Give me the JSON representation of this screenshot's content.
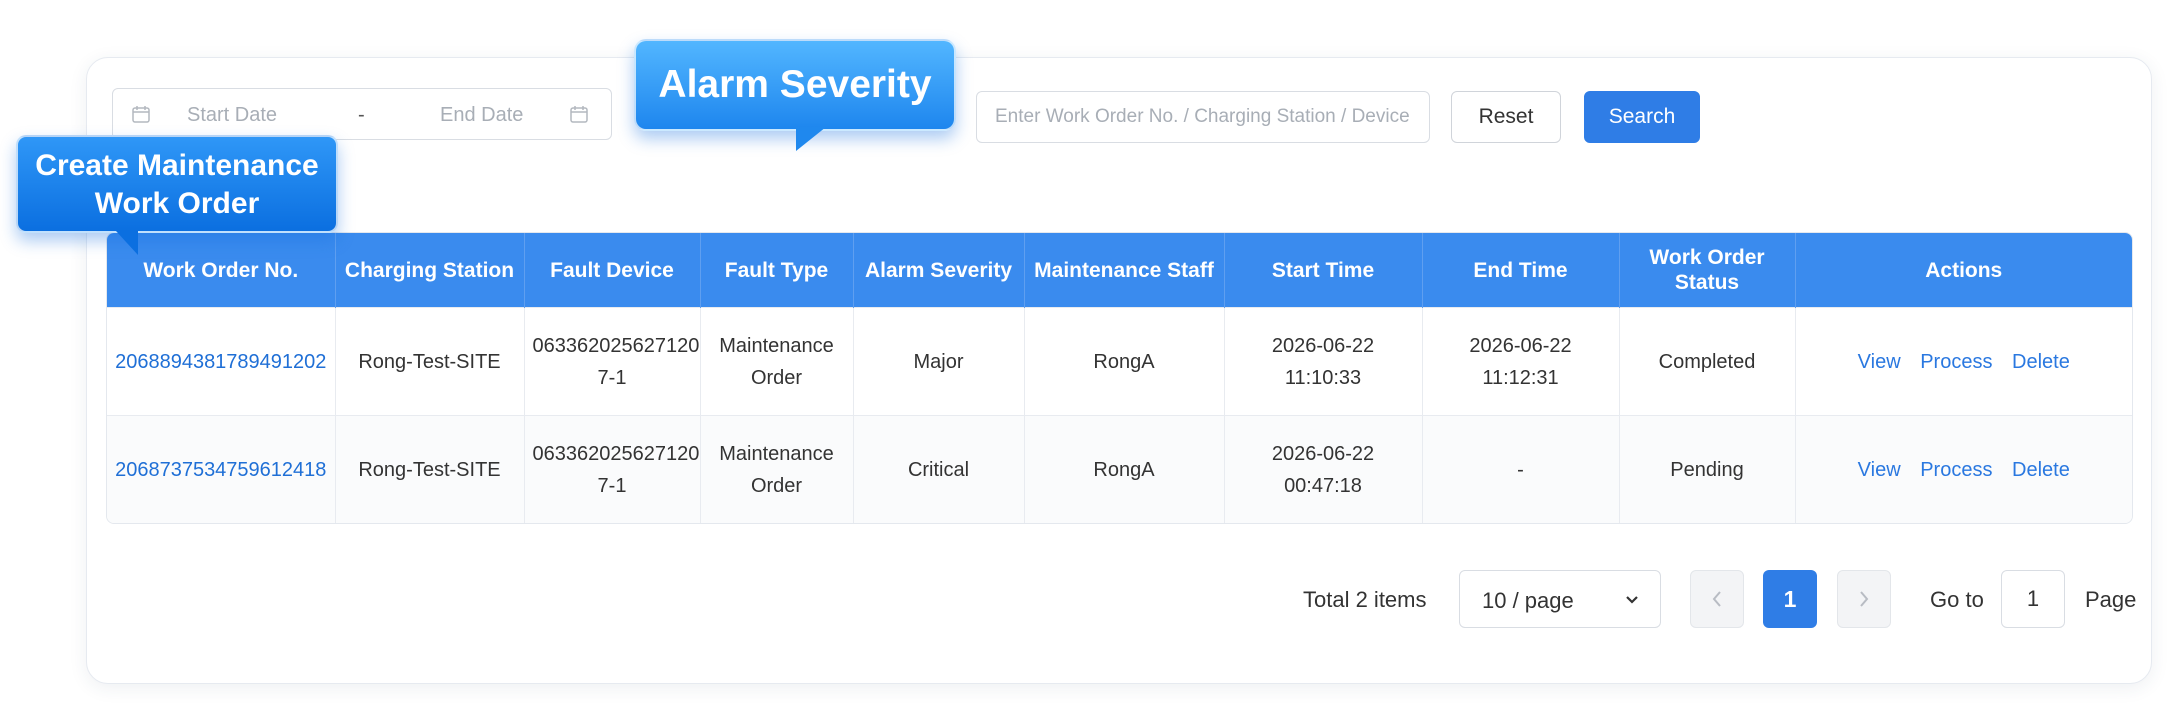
{
  "filters": {
    "start_date_placeholder": "Start Date",
    "separator": "-",
    "end_date_placeholder": "End Date",
    "search_placeholder": "Enter Work Order No. / Charging Station / Device ID",
    "reset_label": "Reset",
    "search_label": "Search"
  },
  "callouts": {
    "alarm_severity": "Alarm Severity",
    "create_line1": "Create Maintenance",
    "create_line2": "Work Order"
  },
  "table": {
    "headers": [
      "Work Order No.",
      "Charging Station",
      "Fault Device",
      "Fault Type",
      "Alarm Severity",
      "Maintenance Staff",
      "Start Time",
      "End Time",
      "Work Order Status",
      "Actions"
    ],
    "rows": [
      {
        "work_order_no": "2068894381789491202",
        "charging_station": "Rong-Test-SITE",
        "fault_device_l1": "063362025627120",
        "fault_device_l2": "7-1",
        "fault_type_l1": "Maintenance",
        "fault_type_l2": "Order",
        "alarm_severity": "Major",
        "maintenance_staff": "RongA",
        "start_time": "2026-06-22 11:10:33",
        "end_time": "2026-06-22 11:12:31",
        "status": "Completed"
      },
      {
        "work_order_no": "2068737534759612418",
        "charging_station": "Rong-Test-SITE",
        "fault_device_l1": "063362025627120",
        "fault_device_l2": "7-1",
        "fault_type_l1": "Maintenance",
        "fault_type_l2": "Order",
        "alarm_severity": "Critical",
        "maintenance_staff": "RongA",
        "start_time": "2026-06-22 00:47:18",
        "end_time": "-",
        "status": "Pending"
      }
    ],
    "actions": {
      "view": "View",
      "process": "Process",
      "delete": "Delete"
    }
  },
  "pagination": {
    "total_text": "Total 2 items",
    "page_size": "10 / page",
    "current_page": "1",
    "goto_label": "Go to",
    "goto_value": "1",
    "page_label": "Page"
  },
  "colors": {
    "primary": "#2f7de6",
    "header_bg": "#3a8bee",
    "link": "#1f6fd6"
  },
  "icons": [
    "calendar-icon",
    "chevron-down-icon",
    "chevron-left-icon",
    "chevron-right-icon"
  ]
}
